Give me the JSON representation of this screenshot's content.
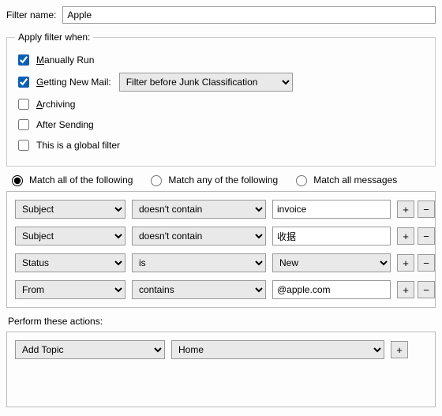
{
  "filter_name_label": "Filter name:",
  "filter_name_value": "Apple",
  "apply_when": {
    "legend": "Apply filter when:",
    "manually_run": {
      "label_pre": "",
      "underline": "M",
      "label_post": "anually Run",
      "checked": true
    },
    "getting_new_mail": {
      "underline": "G",
      "label_post": "etting New Mail:",
      "checked": true,
      "select_value": "Filter before Junk Classification"
    },
    "archiving": {
      "underline": "A",
      "label_post": "rchiving",
      "checked": false
    },
    "after_sending": {
      "label": "After Sending",
      "checked": false
    },
    "global_filter": {
      "label": "This is a global filter",
      "checked": false
    }
  },
  "match_mode": {
    "all": {
      "pre": "M",
      "u": "a",
      "post": "tch all of the following",
      "selected": true
    },
    "any": {
      "pre": "Match any ",
      "u": "o",
      "post": "f the following",
      "selected": false
    },
    "msgs": {
      "label": "Match all messages",
      "selected": false
    }
  },
  "rules": [
    {
      "field": "Subject",
      "op": "doesn't contain",
      "value": "invoice",
      "value_type": "text"
    },
    {
      "field": "Subject",
      "op": "doesn't contain",
      "value": "收据",
      "value_type": "text"
    },
    {
      "field": "Status",
      "op": "is",
      "value": "New",
      "value_type": "select"
    },
    {
      "field": "From",
      "op": "contains",
      "value": "@apple.com",
      "value_type": "text"
    }
  ],
  "perform_label": "Perform these actions:",
  "actions": [
    {
      "name": "Add Topic",
      "value": "Home"
    }
  ],
  "plus": "+",
  "minus": "−"
}
